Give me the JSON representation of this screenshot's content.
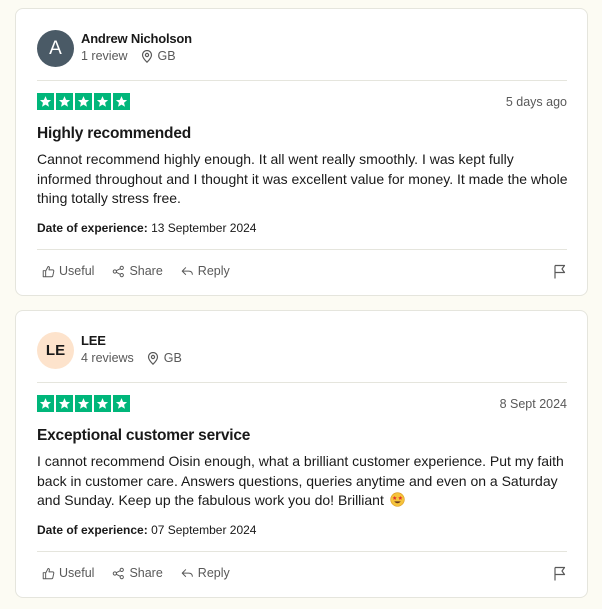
{
  "reviews": [
    {
      "avatar_text": "A",
      "name": "Andrew Nicholson",
      "review_count": "1 review",
      "country": "GB",
      "rating": 5,
      "date": "5 days ago",
      "title": "Highly recommended",
      "body": "Cannot recommend highly enough. It all went really smoothly. I was kept fully informed throughout and I thought it was excellent value for money. It made the whole thing totally stress free.",
      "experience_label": "Date of experience:",
      "experience_date": "13 September 2024",
      "actions": {
        "useful": "Useful",
        "share": "Share",
        "reply": "Reply"
      }
    },
    {
      "avatar_text": "LE",
      "name": "LEE",
      "review_count": "4 reviews",
      "country": "GB",
      "rating": 5,
      "date": "8 Sept 2024",
      "title": "Exceptional customer service",
      "body": "I cannot recommend Oisin enough, what a brilliant customer experience. Put my faith back in customer care. Answers questions, queries anytime and even on a Saturday and Sunday. Keep up the fabulous work you do! Brilliant",
      "body_emoji": "star-struck-emoji",
      "experience_label": "Date of experience:",
      "experience_date": "07 September 2024",
      "actions": {
        "useful": "Useful",
        "share": "Share",
        "reply": "Reply"
      }
    }
  ],
  "colors": {
    "star_green": "#00b67a",
    "avatar_dark": "#4a5a66",
    "avatar_peach": "#fde3cc",
    "page_bg": "#fcfbf3"
  }
}
